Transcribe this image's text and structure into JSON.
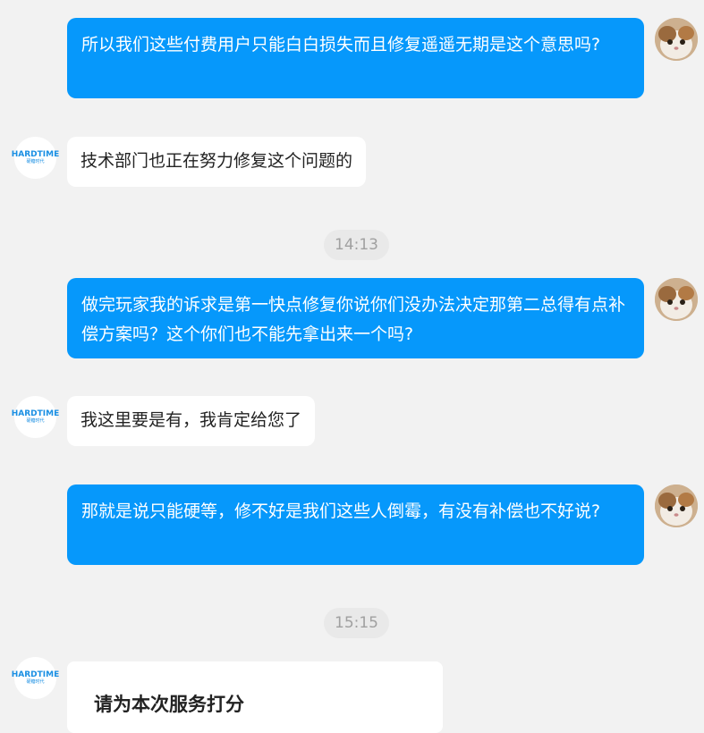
{
  "conversation": {
    "messages": [
      {
        "role": "user",
        "text": "所以我们这些付费用户只能白白损失而且修复遥遥无期是这个意思吗?"
      },
      {
        "role": "agent",
        "text": "技术部门也正在努力修复这个问题的"
      },
      {
        "role": "timestamp",
        "text": "14:13"
      },
      {
        "role": "user",
        "text": "做完玩家我的诉求是第一快点修复你说你们没办法决定那第二总得有点补偿方案吗？这个你们也不能先拿出来一个吗?"
      },
      {
        "role": "agent",
        "text": "我这里要是有，我肯定给您了"
      },
      {
        "role": "user",
        "text": "那就是说只能硬等，修不好是我们这些人倒霉，有没有补偿也不好说?"
      },
      {
        "role": "timestamp",
        "text": "15:15"
      }
    ],
    "rating_card": {
      "title": "请为本次服务打分"
    }
  },
  "agent_avatar": {
    "brand": "HARDTIME",
    "brand_sub": "硬糖时代"
  },
  "colors": {
    "user_bubble": "#0698fb",
    "agent_bubble": "#ffffff",
    "background": "#f2f2f2",
    "brand": "#1a8fe3"
  }
}
